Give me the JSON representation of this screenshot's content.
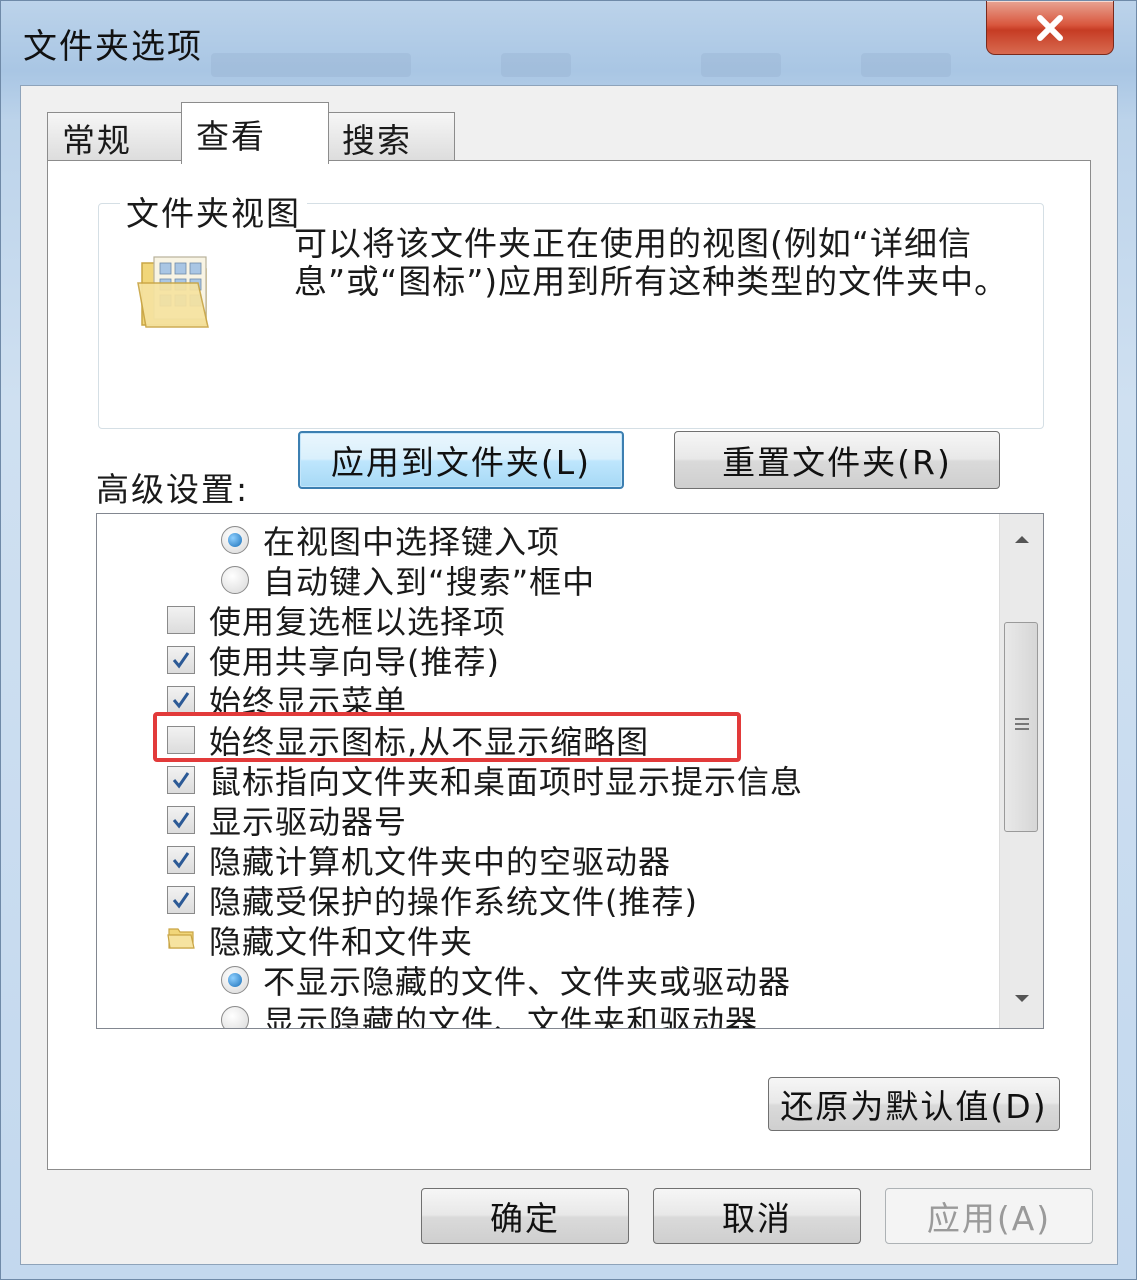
{
  "window": {
    "title": "文件夹选项",
    "accent": "#c63c24",
    "highlight_color": "#e23a3a"
  },
  "tabs": [
    {
      "label": "常规",
      "active": false
    },
    {
      "label": "查看",
      "active": true
    },
    {
      "label": "搜索",
      "active": false
    }
  ],
  "folder_view": {
    "legend": "文件夹视图",
    "description": "可以将该文件夹正在使用的视图(例如“详细信息”或“图标”)应用到所有这种类型的文件夹中。",
    "apply_button": "应用到文件夹(L)",
    "reset_button": "重置文件夹(R)"
  },
  "advanced": {
    "label": "高级设置:",
    "items": [
      {
        "type": "radio",
        "checked": true,
        "label": "在视图中选择键入项"
      },
      {
        "type": "radio",
        "checked": false,
        "label": "自动键入到“搜索”框中"
      },
      {
        "type": "checkbox",
        "checked": false,
        "label": "使用复选框以选择项"
      },
      {
        "type": "checkbox",
        "checked": true,
        "label": "使用共享向导(推荐)"
      },
      {
        "type": "checkbox",
        "checked": true,
        "label": "始终显示菜单"
      },
      {
        "type": "checkbox",
        "checked": false,
        "label": "始终显示图标,从不显示缩略图"
      },
      {
        "type": "checkbox",
        "checked": true,
        "label": "鼠标指向文件夹和桌面项时显示提示信息"
      },
      {
        "type": "checkbox",
        "checked": true,
        "label": "显示驱动器号"
      },
      {
        "type": "checkbox",
        "checked": true,
        "label": "隐藏计算机文件夹中的空驱动器"
      },
      {
        "type": "checkbox",
        "checked": true,
        "label": "隐藏受保护的操作系统文件(推荐)"
      },
      {
        "type": "folder",
        "label": "隐藏文件和文件夹"
      },
      {
        "type": "radio",
        "checked": true,
        "label": "不显示隐藏的文件、文件夹或驱动器"
      },
      {
        "type": "radio",
        "checked": false,
        "label": "显示隐藏的文件、文件夹和驱动器"
      }
    ]
  },
  "restore_defaults": "还原为默认值(D)",
  "footer": {
    "ok": "确定",
    "cancel": "取消",
    "apply": "应用(A)"
  }
}
